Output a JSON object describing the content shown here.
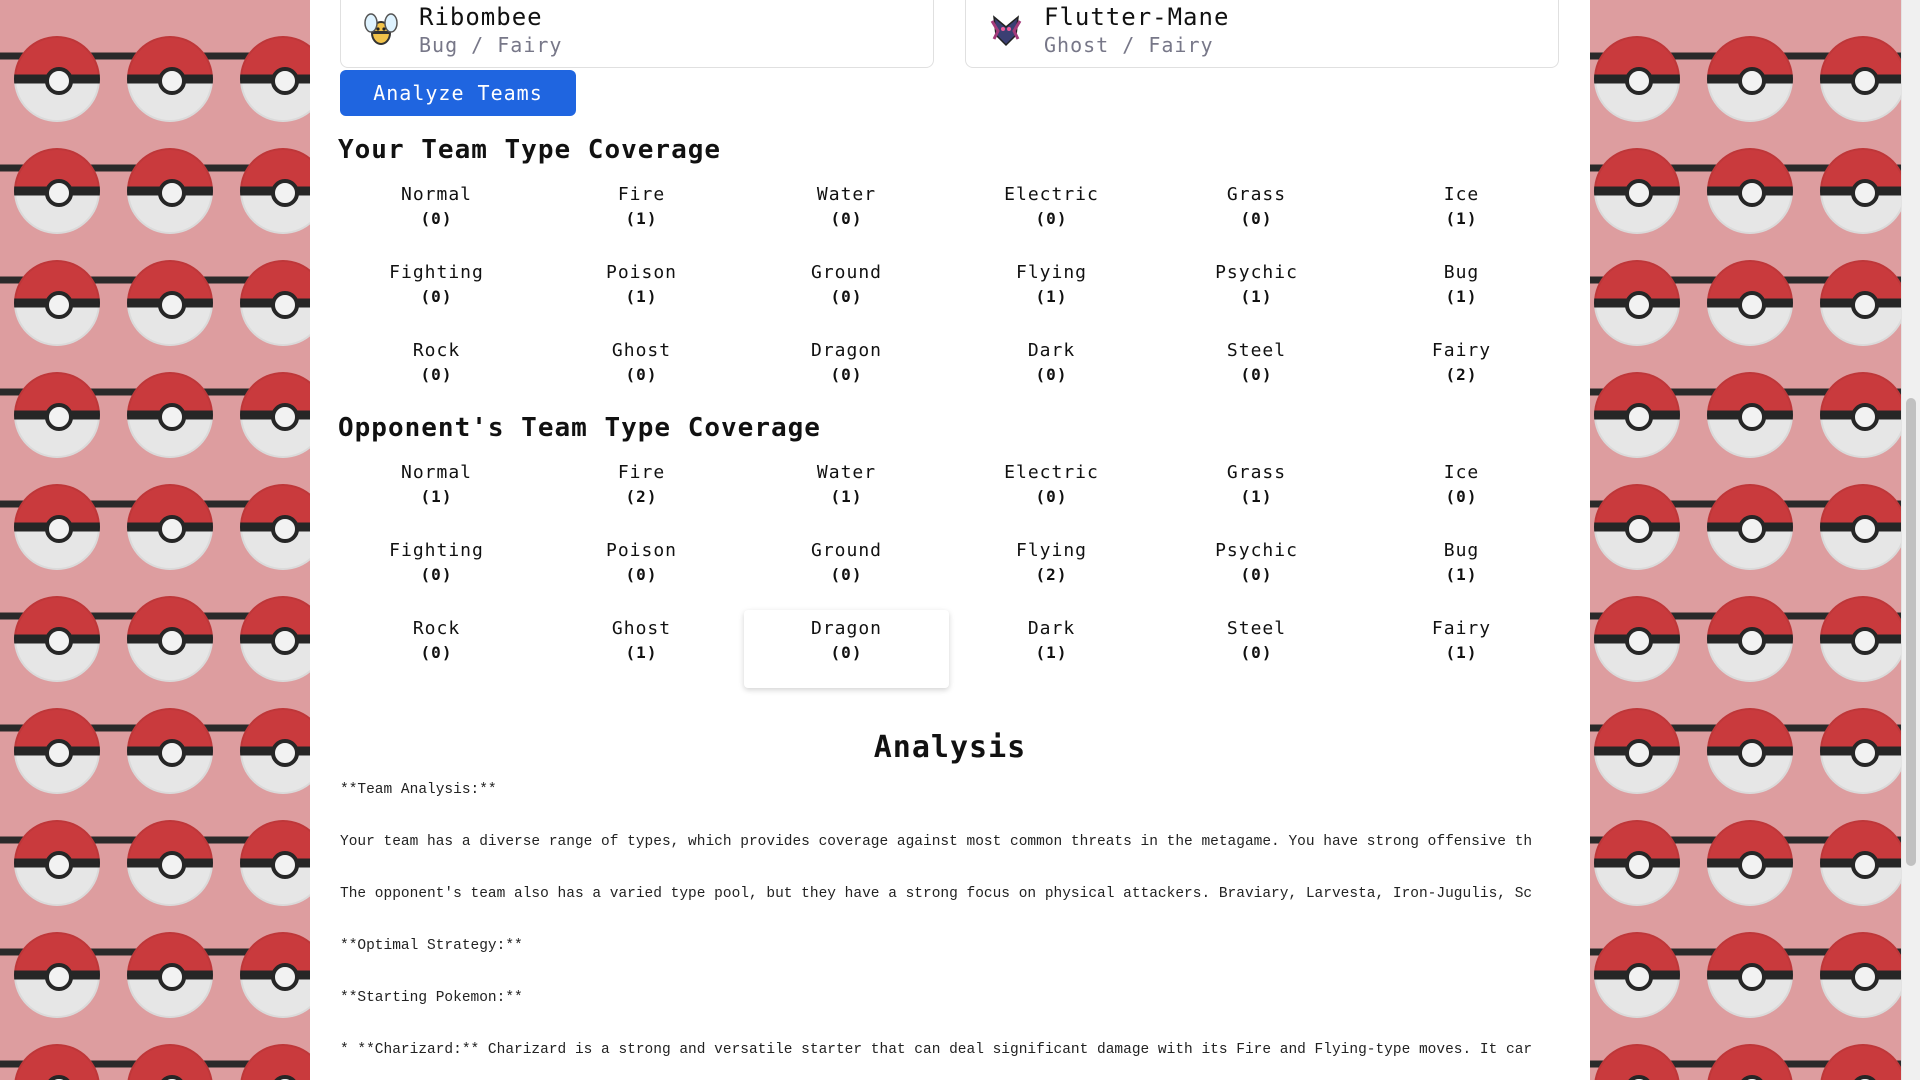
{
  "team_cards": [
    {
      "name": "Ribombee",
      "types": "Bug / Fairy"
    },
    {
      "name": "Flutter-Mane",
      "types": "Ghost / Fairy"
    }
  ],
  "analyze_button": "Analyze Teams",
  "your_coverage": {
    "title": "Your Team Type Coverage",
    "items": [
      {
        "type": "Normal",
        "count": "(0)"
      },
      {
        "type": "Fire",
        "count": "(1)"
      },
      {
        "type": "Water",
        "count": "(0)"
      },
      {
        "type": "Electric",
        "count": "(0)"
      },
      {
        "type": "Grass",
        "count": "(0)"
      },
      {
        "type": "Ice",
        "count": "(1)"
      },
      {
        "type": "Fighting",
        "count": "(0)"
      },
      {
        "type": "Poison",
        "count": "(1)"
      },
      {
        "type": "Ground",
        "count": "(0)"
      },
      {
        "type": "Flying",
        "count": "(1)"
      },
      {
        "type": "Psychic",
        "count": "(1)"
      },
      {
        "type": "Bug",
        "count": "(1)"
      },
      {
        "type": "Rock",
        "count": "(0)"
      },
      {
        "type": "Ghost",
        "count": "(0)"
      },
      {
        "type": "Dragon",
        "count": "(0)"
      },
      {
        "type": "Dark",
        "count": "(0)"
      },
      {
        "type": "Steel",
        "count": "(0)"
      },
      {
        "type": "Fairy",
        "count": "(2)"
      }
    ]
  },
  "opponent_coverage": {
    "title": "Opponent's Team Type Coverage",
    "items": [
      {
        "type": "Normal",
        "count": "(1)"
      },
      {
        "type": "Fire",
        "count": "(2)"
      },
      {
        "type": "Water",
        "count": "(1)"
      },
      {
        "type": "Electric",
        "count": "(0)"
      },
      {
        "type": "Grass",
        "count": "(1)"
      },
      {
        "type": "Ice",
        "count": "(0)"
      },
      {
        "type": "Fighting",
        "count": "(0)"
      },
      {
        "type": "Poison",
        "count": "(0)"
      },
      {
        "type": "Ground",
        "count": "(0)"
      },
      {
        "type": "Flying",
        "count": "(2)"
      },
      {
        "type": "Psychic",
        "count": "(0)"
      },
      {
        "type": "Bug",
        "count": "(1)"
      },
      {
        "type": "Rock",
        "count": "(0)"
      },
      {
        "type": "Ghost",
        "count": "(1)"
      },
      {
        "type": "Dragon",
        "count": "(0)"
      },
      {
        "type": "Dark",
        "count": "(1)"
      },
      {
        "type": "Steel",
        "count": "(0)"
      },
      {
        "type": "Fairy",
        "count": "(1)"
      }
    ]
  },
  "analysis": {
    "title": "Analysis",
    "paragraphs": [
      "**Team Analysis:**",
      "Your team has a diverse range of types, which provides coverage against most common threats in the metagame. You have strong offensive th",
      "The opponent's team also has a varied type pool, but they have a strong focus on physical attackers. Braviary, Larvesta, Iron-Jugulis, Sc",
      "**Optimal Strategy:**",
      "**Starting Pokemon:**",
      "* **Charizard:** Charizard is a strong and versatile starter that can deal significant damage with its Fire and Flying-type moves. It car"
    ]
  },
  "colors": {
    "button": "#1f65e0",
    "background": "#dd9d9f",
    "pokeball_red": "#c93a3d"
  }
}
